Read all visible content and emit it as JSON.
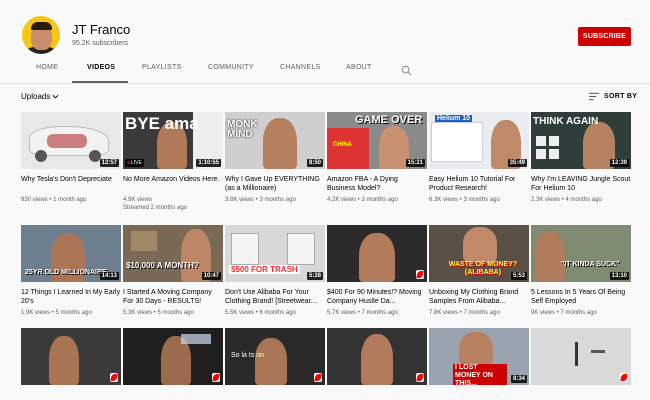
{
  "channel": {
    "name": "JT Franco",
    "subscribers": "95.2K subscribers",
    "subscribe_label": "SUBSCRIBE"
  },
  "tabs": [
    "HOME",
    "VIDEOS",
    "PLAYLISTS",
    "COMMUNITY",
    "CHANNELS",
    "ABOUT"
  ],
  "active_tab": "VIDEOS",
  "uploads_label": "Uploads",
  "sort_label": "SORT BY",
  "videos": [
    {
      "title": "Why Tesla's Don't Depreciate",
      "views": "930 views",
      "age": "1 month ago",
      "duration": "12:57",
      "overlay": ""
    },
    {
      "title": "No More Amazon Videos Here.",
      "views": "4.9K views",
      "age": "Streamed 2 months ago",
      "duration": "1:10:55",
      "overlay": "BYE ama",
      "live": "LIVE"
    },
    {
      "title": "Why I Gave Up EVERYTHING (as a Millionaire)",
      "views": "3.8K views",
      "age": "3 months ago",
      "duration": "8:50",
      "overlay": "MONK MIND"
    },
    {
      "title": "Amazon FBA - A Dying Business Model?",
      "views": "4.2K views",
      "age": "3 months ago",
      "duration": "15:21",
      "overlay": "GAME OVER",
      "sub_overlay": "CHINA"
    },
    {
      "title": "Easy Helium 10 Tutorial For Product Research!",
      "views": "6.3K views",
      "age": "3 months ago",
      "duration": "35:49",
      "overlay": "Helium 10"
    },
    {
      "title": "Why I'm LEAVING Jungle Scout For Helium 10",
      "views": "2.3K views",
      "age": "4 months ago",
      "duration": "12:39",
      "overlay": "THINK AGAIN"
    },
    {
      "title": "12 Things I Learned In My Early 20's",
      "views": "1.9K views",
      "age": "5 months ago",
      "duration": "14:13",
      "overlay": "25YR OLD MILLIONAIRE"
    },
    {
      "title": "I Started A Moving Company For 30 Days - RESULTS!",
      "views": "5.3K views",
      "age": "5 months ago",
      "duration": "10:47",
      "overlay": "$10,000 A MONTH?"
    },
    {
      "title": "Don't Use Alibaba For Your Clothing Brand! [Streetwear...",
      "views": "5.5K views",
      "age": "6 months ago",
      "duration": "5:28",
      "overlay": "$500 FOR TRASH"
    },
    {
      "title": "$400 For 90 Minutes!? Moving Company Hustle Da...",
      "views": "5.7K views",
      "age": "7 months ago",
      "duration": "",
      "overlay": ""
    },
    {
      "title": "Unboxing My Clothing Brand Samples From Alibaba...",
      "views": "7.8K views",
      "age": "7 months ago",
      "duration": "5:53",
      "overlay": "WASTE OF MONEY? (ALIBABA)"
    },
    {
      "title": "5 Lessons In 5 Years Of Being Self Employed",
      "views": "9K views",
      "age": "7 months ago",
      "duration": "13:10",
      "overlay": "\"IT KINDA SUCK\""
    },
    {
      "title": "",
      "views": "",
      "age": "",
      "duration": "",
      "overlay": ""
    },
    {
      "title": "",
      "views": "",
      "age": "",
      "duration": "",
      "overlay": ""
    },
    {
      "title": "",
      "views": "",
      "age": "",
      "duration": "",
      "overlay": "So la  ts on"
    },
    {
      "title": "",
      "views": "",
      "age": "",
      "duration": "",
      "overlay": ""
    },
    {
      "title": "",
      "views": "",
      "age": "",
      "duration": "8:34",
      "overlay": "I LOST MONEY ON THIS..."
    },
    {
      "title": "",
      "views": "",
      "age": "",
      "duration": "",
      "overlay": ""
    }
  ]
}
